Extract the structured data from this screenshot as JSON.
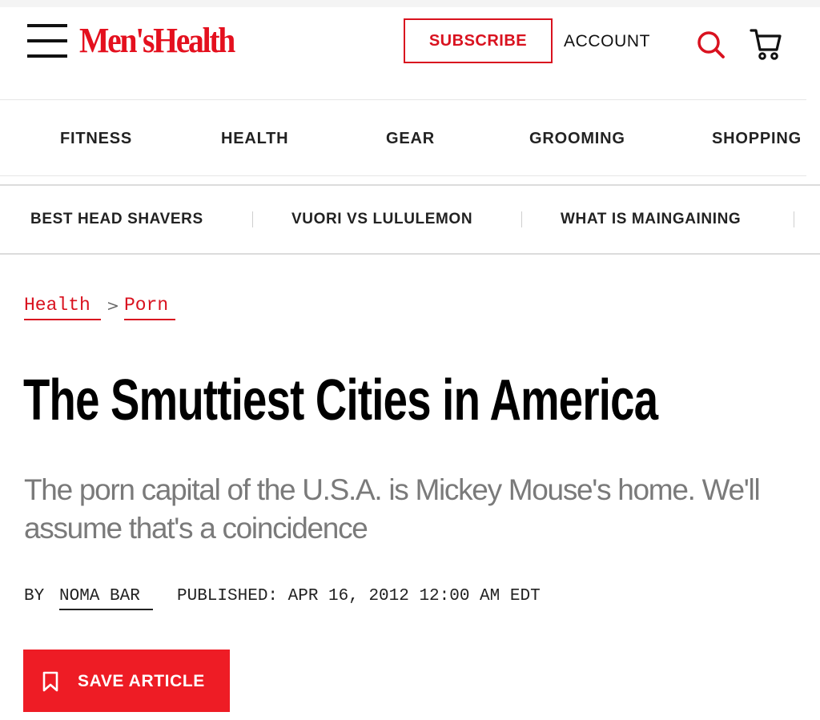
{
  "header": {
    "logo_text": "Men'sHealth",
    "subscribe_label": "SUBSCRIBE",
    "account_label": "ACCOUNT",
    "icons": [
      "menu-icon",
      "search-icon",
      "cart-icon"
    ],
    "brand_color": "#E4101E"
  },
  "nav": {
    "items": [
      {
        "label": "FITNESS"
      },
      {
        "label": "HEALTH"
      },
      {
        "label": "GEAR"
      },
      {
        "label": "GROOMING"
      },
      {
        "label": "SHOPPING"
      }
    ]
  },
  "trending": {
    "items": [
      {
        "label": "BEST HEAD SHAVERS"
      },
      {
        "label": "VUORI VS LULULEMON"
      },
      {
        "label": "WHAT IS MAINGAINING"
      }
    ]
  },
  "breadcrumb": {
    "items": [
      {
        "label": "Health"
      },
      {
        "label": "Porn"
      }
    ],
    "separator": ">"
  },
  "article": {
    "title": "The Smuttiest Cities in America",
    "subtitle": "The porn capital of the U.S.A. is Mickey Mouse's home. We'll assume that's a coincidence",
    "byline_prefix": "BY",
    "author": "NOMA BAR",
    "published": "PUBLISHED: APR 16, 2012 12:00 AM EDT",
    "save_label": "SAVE ARTICLE",
    "save_icon": "bookmark-icon",
    "save_color": "#EE1C25"
  }
}
